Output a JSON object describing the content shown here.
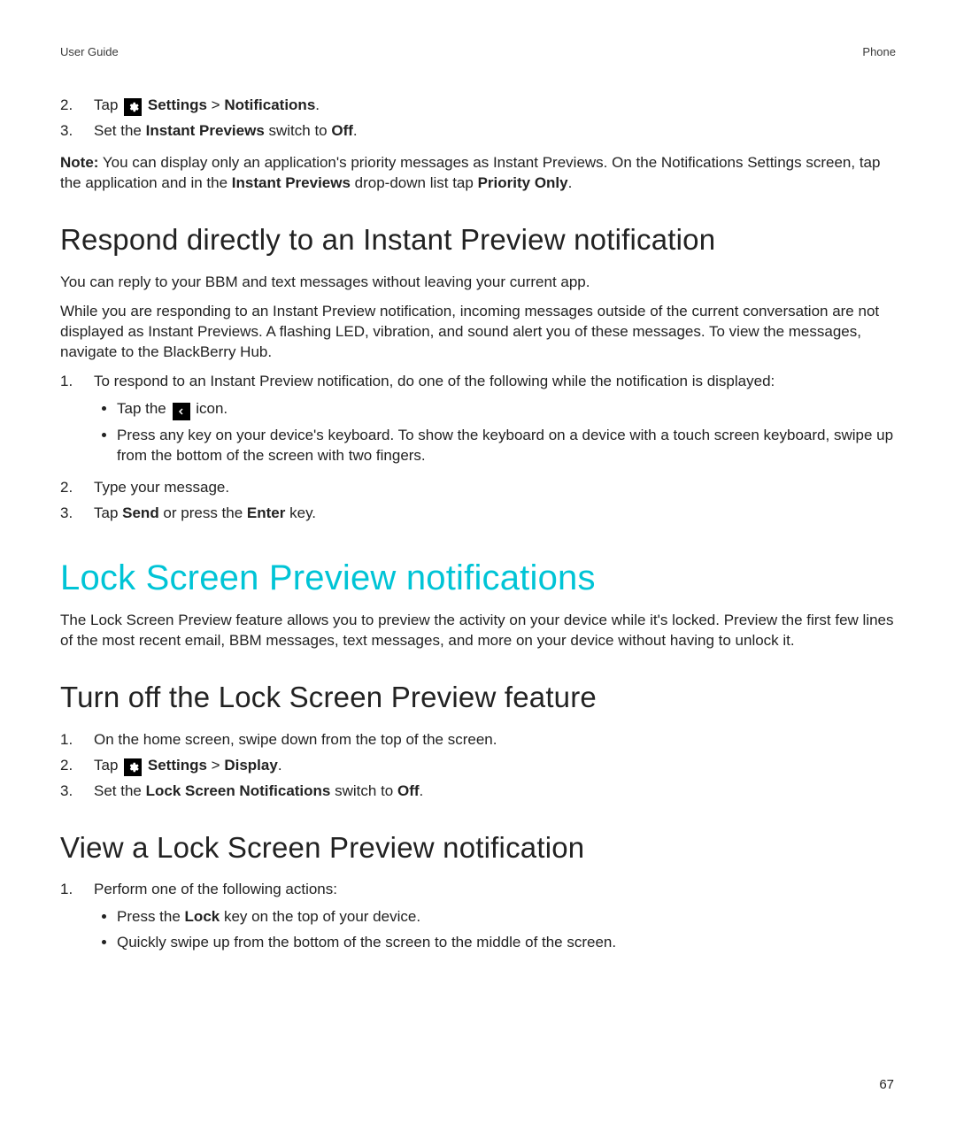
{
  "header": {
    "left": "User Guide",
    "right": "Phone"
  },
  "page_number": "67",
  "top_steps": [
    {
      "num": "2.",
      "pre": "Tap ",
      "icon": "settings-gear-icon",
      "seq": [
        "Settings",
        "Notifications"
      ],
      "post": "."
    },
    {
      "num": "3.",
      "pre": "Set the ",
      "bold1": "Instant Previews",
      "mid": " switch to ",
      "bold2": "Off",
      "post": "."
    }
  ],
  "note": {
    "label": "Note:",
    "text1": " You can display only an application's priority messages as Instant Previews. On the Notifications Settings screen, tap the application and in the ",
    "bold1": "Instant Previews",
    "text2": " drop-down list tap ",
    "bold2": "Priority Only",
    "text3": "."
  },
  "respond": {
    "heading": "Respond directly to an Instant Preview notification",
    "p1": "You can reply to your BBM and text messages without leaving your current app.",
    "p2": "While you are responding to an Instant Preview notification, incoming messages outside of the current conversation are not displayed as Instant Previews. A flashing LED, vibration, and sound alert you of these messages. To view the messages, navigate to the BlackBerry Hub.",
    "step1_num": "1.",
    "step1_text": "To respond to an Instant Preview notification, do one of the following while the notification is displayed:",
    "bullet1_pre": "Tap the ",
    "bullet1_icon": "reply-arrow-icon",
    "bullet1_post": " icon.",
    "bullet2": "Press any key on your device's keyboard. To show the keyboard on a device with a touch screen keyboard, swipe up from the bottom of the screen with two fingers.",
    "step2_num": "2.",
    "step2_text": "Type your message.",
    "step3_num": "3.",
    "step3_pre": "Tap ",
    "step3_b1": "Send",
    "step3_mid": " or press the ",
    "step3_b2": "Enter",
    "step3_post": " key."
  },
  "lock": {
    "heading": "Lock Screen Preview notifications",
    "intro": "The Lock Screen Preview feature allows you to preview the activity on your device while it's locked. Preview the first few lines of the most recent email, BBM messages, text messages, and more on your device without having to unlock it."
  },
  "turnoff": {
    "heading": "Turn off the Lock Screen Preview feature",
    "step1_num": "1.",
    "step1_text": "On the home screen, swipe down from the top of the screen.",
    "step2_num": "2.",
    "step2_pre": "Tap ",
    "step2_icon": "settings-gear-icon",
    "step2_seq": [
      "Settings",
      "Display"
    ],
    "step2_post": ".",
    "step3_num": "3.",
    "step3_pre": "Set the ",
    "step3_b1": "Lock Screen Notifications",
    "step3_mid": " switch to ",
    "step3_b2": "Off",
    "step3_post": "."
  },
  "view": {
    "heading": "View a Lock Screen Preview notification",
    "step1_num": "1.",
    "step1_text": "Perform one of the following actions:",
    "bullet1_pre": "Press the ",
    "bullet1_b": "Lock",
    "bullet1_post": " key on the top of your device.",
    "bullet2": "Quickly swipe up from the bottom of the screen to the middle of the screen."
  },
  "sep": ">"
}
